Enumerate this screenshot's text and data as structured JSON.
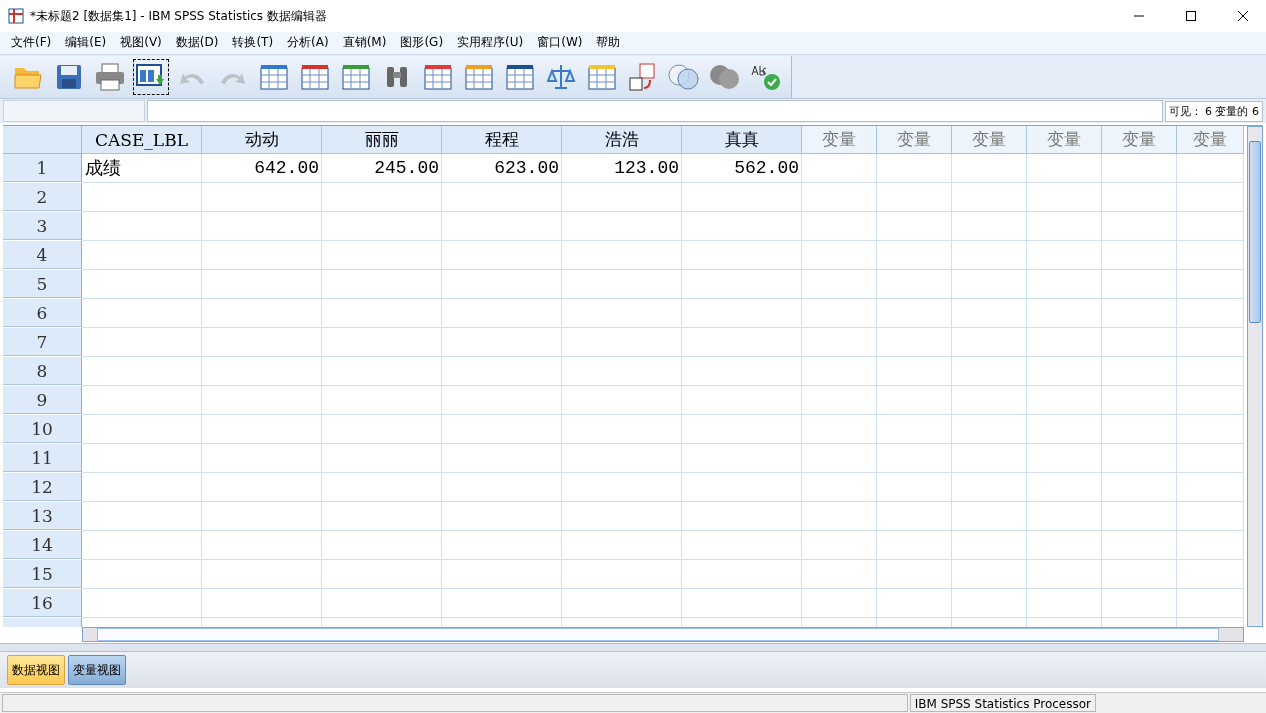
{
  "window": {
    "title": "*未标题2 [数据集1] - IBM SPSS Statistics 数据编辑器"
  },
  "menu": [
    "文件(F)",
    "编辑(E)",
    "视图(V)",
    "数据(D)",
    "转换(T)",
    "分析(A)",
    "直销(M)",
    "图形(G)",
    "实用程序(U)",
    "窗口(W)",
    "帮助"
  ],
  "toolbar": [
    {
      "kind": "open",
      "disabled": false
    },
    {
      "kind": "save",
      "disabled": false
    },
    {
      "kind": "print",
      "disabled": false
    },
    {
      "kind": "dialog",
      "disabled": false
    },
    {
      "kind": "undo",
      "disabled": true
    },
    {
      "kind": "redo",
      "disabled": true
    },
    {
      "kind": "goto",
      "disabled": false
    },
    {
      "kind": "insert",
      "disabled": false
    },
    {
      "kind": "variables",
      "disabled": false
    },
    {
      "kind": "find",
      "disabled": false
    },
    {
      "kind": "insertcase",
      "disabled": false
    },
    {
      "kind": "insertvar",
      "disabled": false
    },
    {
      "kind": "split",
      "disabled": false
    },
    {
      "kind": "weight",
      "disabled": false
    },
    {
      "kind": "select",
      "disabled": false
    },
    {
      "kind": "labels",
      "disabled": false
    },
    {
      "kind": "sets",
      "disabled": false
    },
    {
      "kind": "showsets",
      "disabled": false
    },
    {
      "kind": "spell",
      "disabled": false
    }
  ],
  "visible_info": "可见： 6 变量的 6",
  "table": {
    "columns": [
      {
        "label": "CASE_LBL",
        "defined": true
      },
      {
        "label": "动动",
        "defined": true
      },
      {
        "label": "丽丽",
        "defined": true
      },
      {
        "label": "程程",
        "defined": true
      },
      {
        "label": "浩浩",
        "defined": true
      },
      {
        "label": "真真",
        "defined": true
      },
      {
        "label": "变量",
        "defined": false
      },
      {
        "label": "变量",
        "defined": false
      },
      {
        "label": "变量",
        "defined": false
      },
      {
        "label": "变量",
        "defined": false
      },
      {
        "label": "变量",
        "defined": false
      },
      {
        "label": "变量",
        "defined": false
      }
    ],
    "row_numbers": [
      "1",
      "2",
      "3",
      "4",
      "5",
      "6",
      "7",
      "8",
      "9",
      "10",
      "11",
      "12",
      "13",
      "14",
      "15",
      "16"
    ],
    "rows": [
      [
        "成绩",
        "642.00",
        "245.00",
        "623.00",
        "123.00",
        "562.00"
      ]
    ]
  },
  "tabs": [
    {
      "label": "数据视图",
      "selected": true
    },
    {
      "label": "变量视图",
      "selected": false
    }
  ],
  "status_bar": {
    "processor": "IBM SPSS Statistics Processor"
  }
}
